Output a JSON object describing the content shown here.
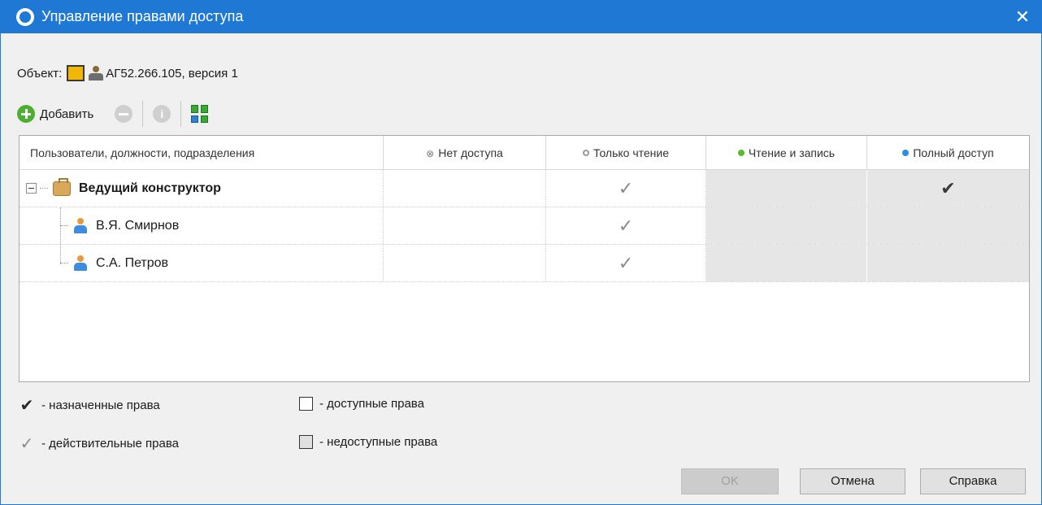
{
  "window": {
    "title": "Управление правами доступа",
    "close_glyph": "✕",
    "accent_color": "#1e78d4"
  },
  "object": {
    "label": "Объект:",
    "name": "АГ52.266.105, версия 1"
  },
  "toolbar": {
    "add_label": "Добавить",
    "info_glyph": "i"
  },
  "table": {
    "columns": [
      {
        "label": "Пользователи, должности, подразделения",
        "dot": ""
      },
      {
        "label": "Нет доступа",
        "dot": "⊗"
      },
      {
        "label": "Только чтение",
        "dot": "#9a9a9a"
      },
      {
        "label": "Чтение и запись",
        "dot": "#5cb82e"
      },
      {
        "label": "Полный доступ",
        "dot": "#2d8fe0"
      }
    ],
    "rows": [
      {
        "name": "Ведущий конструктор",
        "type": "role-icon",
        "read_only": "✓ effective",
        "full_access": "✔ assigned"
      },
      {
        "name": "В.Я. Смирнов",
        "type": "user-icon",
        "read_only": "✓ effective"
      },
      {
        "name": "С.А. Петров",
        "type": "user-icon",
        "read_only": "✓ effective"
      }
    ],
    "check_outline_glyph": "✓",
    "check_solid_glyph": "✔",
    "no_access_glyph": "⊗",
    "dot_glyph": "●"
  },
  "legend": {
    "assigned": "- назначенные права",
    "effective": "- действительные права",
    "available": "- доступные права",
    "unavailable": "- недоступные права"
  },
  "buttons": {
    "ok": "OK",
    "cancel": "Отмена",
    "help": "Справка"
  }
}
